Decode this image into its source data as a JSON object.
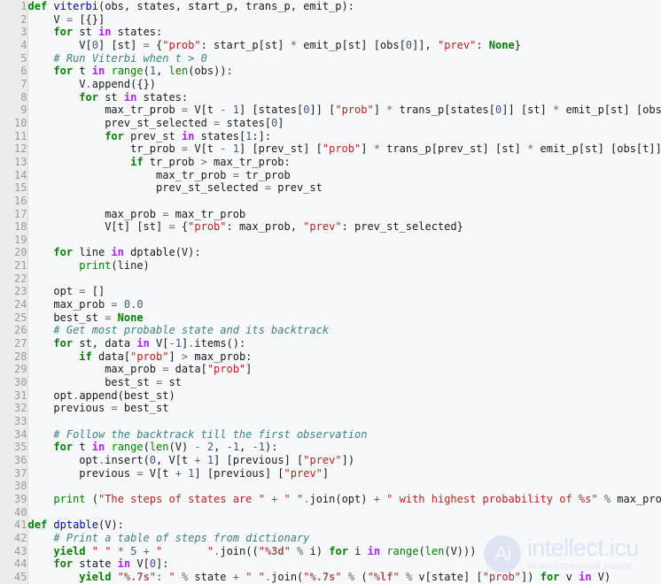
{
  "viewer": {
    "language": "python",
    "line_count": 45,
    "background_color": "#f7f8fa",
    "gutter_background_color": "#ececec",
    "gutter_text_color": "#9a9a9a",
    "first_line_number": 1
  },
  "watermark": {
    "badge_glyph": "Ai",
    "title": "intellect.icu",
    "subtitle": "Искусственный разум",
    "color": "#dde3f3"
  },
  "theme": {
    "keyword": "#008000",
    "keyword_operator": "#aa22ff",
    "function_name": "#0000c0",
    "builtin": "#008000",
    "string": "#ba2121",
    "string_format": "#a45a5a",
    "number": "#445588",
    "comment": "#408080",
    "operator": "#666666",
    "plain": "#1a1a1a"
  },
  "lines": [
    {
      "n": "1",
      "tokens": [
        [
          "kw",
          "def"
        ],
        [
          "pl",
          " "
        ],
        [
          "fn",
          "viterbi"
        ],
        [
          "pl",
          "(obs, states, start_p, trans_p, emit_p):"
        ]
      ]
    },
    {
      "n": "2",
      "tokens": [
        [
          "pl",
          "    V "
        ],
        [
          "op",
          "="
        ],
        [
          "pl",
          " [{}]"
        ]
      ]
    },
    {
      "n": "3",
      "tokens": [
        [
          "pl",
          "    "
        ],
        [
          "kw",
          "for"
        ],
        [
          "pl",
          " st "
        ],
        [
          "kwop",
          "in"
        ],
        [
          "pl",
          " states:"
        ]
      ]
    },
    {
      "n": "4",
      "tokens": [
        [
          "pl",
          "        V["
        ],
        [
          "num",
          "0"
        ],
        [
          "pl",
          "] [st] "
        ],
        [
          "op",
          "="
        ],
        [
          "pl",
          " {"
        ],
        [
          "str",
          "\"prob\""
        ],
        [
          "pl",
          ": start_p[st] "
        ],
        [
          "op",
          "*"
        ],
        [
          "pl",
          " emit_p[st] [obs["
        ],
        [
          "num",
          "0"
        ],
        [
          "pl",
          "]], "
        ],
        [
          "str",
          "\"prev\""
        ],
        [
          "pl",
          ": "
        ],
        [
          "kw",
          "None"
        ],
        [
          "pl",
          "}"
        ]
      ]
    },
    {
      "n": "5",
      "tokens": [
        [
          "pl",
          "    "
        ],
        [
          "com",
          "# Run Viterbi when t > 0"
        ]
      ]
    },
    {
      "n": "6",
      "tokens": [
        [
          "pl",
          "    "
        ],
        [
          "kw",
          "for"
        ],
        [
          "pl",
          " t "
        ],
        [
          "kwop",
          "in"
        ],
        [
          "pl",
          " "
        ],
        [
          "bi",
          "range"
        ],
        [
          "pl",
          "("
        ],
        [
          "num",
          "1"
        ],
        [
          "pl",
          ", "
        ],
        [
          "bi",
          "len"
        ],
        [
          "pl",
          "(obs)):"
        ]
      ]
    },
    {
      "n": "7",
      "tokens": [
        [
          "pl",
          "        V"
        ],
        [
          "op",
          "."
        ],
        [
          "pl",
          "append({})"
        ]
      ]
    },
    {
      "n": "8",
      "tokens": [
        [
          "pl",
          "        "
        ],
        [
          "kw",
          "for"
        ],
        [
          "pl",
          " st "
        ],
        [
          "kwop",
          "in"
        ],
        [
          "pl",
          " states:"
        ]
      ]
    },
    {
      "n": "9",
      "tokens": [
        [
          "pl",
          "            max_tr_prob "
        ],
        [
          "op",
          "="
        ],
        [
          "pl",
          " V[t "
        ],
        [
          "op",
          "-"
        ],
        [
          "pl",
          " "
        ],
        [
          "num",
          "1"
        ],
        [
          "pl",
          "] [states["
        ],
        [
          "num",
          "0"
        ],
        [
          "pl",
          "]] ["
        ],
        [
          "str",
          "\"prob\""
        ],
        [
          "pl",
          "] "
        ],
        [
          "op",
          "*"
        ],
        [
          "pl",
          " trans_p[states["
        ],
        [
          "num",
          "0"
        ],
        [
          "pl",
          "]] [st] "
        ],
        [
          "op",
          "*"
        ],
        [
          "pl",
          " emit_p[st] [obs[t]]"
        ]
      ]
    },
    {
      "n": "10",
      "tokens": [
        [
          "pl",
          "            prev_st_selected "
        ],
        [
          "op",
          "="
        ],
        [
          "pl",
          " states["
        ],
        [
          "num",
          "0"
        ],
        [
          "pl",
          "]"
        ]
      ]
    },
    {
      "n": "11",
      "tokens": [
        [
          "pl",
          "            "
        ],
        [
          "kw",
          "for"
        ],
        [
          "pl",
          " prev_st "
        ],
        [
          "kwop",
          "in"
        ],
        [
          "pl",
          " states["
        ],
        [
          "num",
          "1"
        ],
        [
          "pl",
          ":]:"
        ]
      ]
    },
    {
      "n": "12",
      "tokens": [
        [
          "pl",
          "                tr_prob "
        ],
        [
          "op",
          "="
        ],
        [
          "pl",
          " V[t "
        ],
        [
          "op",
          "-"
        ],
        [
          "pl",
          " "
        ],
        [
          "num",
          "1"
        ],
        [
          "pl",
          "] [prev_st] ["
        ],
        [
          "str",
          "\"prob\""
        ],
        [
          "pl",
          "] "
        ],
        [
          "op",
          "*"
        ],
        [
          "pl",
          " trans_p[prev_st] [st] "
        ],
        [
          "op",
          "*"
        ],
        [
          "pl",
          " emit_p[st] [obs[t]]"
        ]
      ]
    },
    {
      "n": "13",
      "tokens": [
        [
          "pl",
          "                "
        ],
        [
          "kw",
          "if"
        ],
        [
          "pl",
          " tr_prob "
        ],
        [
          "op",
          ">"
        ],
        [
          "pl",
          " max_tr_prob:"
        ]
      ]
    },
    {
      "n": "14",
      "tokens": [
        [
          "pl",
          "                    max_tr_prob "
        ],
        [
          "op",
          "="
        ],
        [
          "pl",
          " tr_prob"
        ]
      ]
    },
    {
      "n": "15",
      "tokens": [
        [
          "pl",
          "                    prev_st_selected "
        ],
        [
          "op",
          "="
        ],
        [
          "pl",
          " prev_st"
        ]
      ]
    },
    {
      "n": "16",
      "tokens": []
    },
    {
      "n": "17",
      "tokens": [
        [
          "pl",
          "            max_prob "
        ],
        [
          "op",
          "="
        ],
        [
          "pl",
          " max_tr_prob"
        ]
      ]
    },
    {
      "n": "18",
      "tokens": [
        [
          "pl",
          "            V[t] [st] "
        ],
        [
          "op",
          "="
        ],
        [
          "pl",
          " {"
        ],
        [
          "str",
          "\"prob\""
        ],
        [
          "pl",
          ": max_prob, "
        ],
        [
          "str",
          "\"prev\""
        ],
        [
          "pl",
          ": prev_st_selected}"
        ]
      ]
    },
    {
      "n": "19",
      "tokens": []
    },
    {
      "n": "20",
      "tokens": [
        [
          "pl",
          "    "
        ],
        [
          "kw",
          "for"
        ],
        [
          "pl",
          " line "
        ],
        [
          "kwop",
          "in"
        ],
        [
          "pl",
          " dptable(V):"
        ]
      ]
    },
    {
      "n": "21",
      "tokens": [
        [
          "pl",
          "        "
        ],
        [
          "bi",
          "print"
        ],
        [
          "pl",
          "(line)"
        ]
      ]
    },
    {
      "n": "22",
      "tokens": []
    },
    {
      "n": "23",
      "tokens": [
        [
          "pl",
          "    opt "
        ],
        [
          "op",
          "="
        ],
        [
          "pl",
          " []"
        ]
      ]
    },
    {
      "n": "24",
      "tokens": [
        [
          "pl",
          "    max_prob "
        ],
        [
          "op",
          "="
        ],
        [
          "pl",
          " "
        ],
        [
          "num",
          "0.0"
        ]
      ]
    },
    {
      "n": "25",
      "tokens": [
        [
          "pl",
          "    best_st "
        ],
        [
          "op",
          "="
        ],
        [
          "pl",
          " "
        ],
        [
          "kw",
          "None"
        ]
      ]
    },
    {
      "n": "26",
      "tokens": [
        [
          "pl",
          "    "
        ],
        [
          "com",
          "# Get most probable state and its backtrack"
        ]
      ]
    },
    {
      "n": "27",
      "tokens": [
        [
          "pl",
          "    "
        ],
        [
          "kw",
          "for"
        ],
        [
          "pl",
          " st, data "
        ],
        [
          "kwop",
          "in"
        ],
        [
          "pl",
          " V["
        ],
        [
          "op",
          "-"
        ],
        [
          "num",
          "1"
        ],
        [
          "pl",
          "]"
        ],
        [
          "op",
          "."
        ],
        [
          "pl",
          "items():"
        ]
      ]
    },
    {
      "n": "28",
      "tokens": [
        [
          "pl",
          "        "
        ],
        [
          "kw",
          "if"
        ],
        [
          "pl",
          " data["
        ],
        [
          "str",
          "\"prob\""
        ],
        [
          "pl",
          "] "
        ],
        [
          "op",
          ">"
        ],
        [
          "pl",
          " max_prob:"
        ]
      ]
    },
    {
      "n": "29",
      "tokens": [
        [
          "pl",
          "            max_prob "
        ],
        [
          "op",
          "="
        ],
        [
          "pl",
          " data["
        ],
        [
          "str",
          "\"prob\""
        ],
        [
          "pl",
          "]"
        ]
      ]
    },
    {
      "n": "30",
      "tokens": [
        [
          "pl",
          "            best_st "
        ],
        [
          "op",
          "="
        ],
        [
          "pl",
          " st"
        ]
      ]
    },
    {
      "n": "31",
      "tokens": [
        [
          "pl",
          "    opt"
        ],
        [
          "op",
          "."
        ],
        [
          "pl",
          "append(best_st)"
        ]
      ]
    },
    {
      "n": "32",
      "tokens": [
        [
          "pl",
          "    previous "
        ],
        [
          "op",
          "="
        ],
        [
          "pl",
          " best_st"
        ]
      ]
    },
    {
      "n": "33",
      "tokens": []
    },
    {
      "n": "34",
      "tokens": [
        [
          "pl",
          "    "
        ],
        [
          "com",
          "# Follow the backtrack till the first observation"
        ]
      ]
    },
    {
      "n": "35",
      "tokens": [
        [
          "pl",
          "    "
        ],
        [
          "kw",
          "for"
        ],
        [
          "pl",
          " t "
        ],
        [
          "kwop",
          "in"
        ],
        [
          "pl",
          " "
        ],
        [
          "bi",
          "range"
        ],
        [
          "pl",
          "("
        ],
        [
          "bi",
          "len"
        ],
        [
          "pl",
          "(V) "
        ],
        [
          "op",
          "-"
        ],
        [
          "pl",
          " "
        ],
        [
          "num",
          "2"
        ],
        [
          "pl",
          ", "
        ],
        [
          "op",
          "-"
        ],
        [
          "num",
          "1"
        ],
        [
          "pl",
          ", "
        ],
        [
          "op",
          "-"
        ],
        [
          "num",
          "1"
        ],
        [
          "pl",
          "):"
        ]
      ]
    },
    {
      "n": "36",
      "tokens": [
        [
          "pl",
          "        opt"
        ],
        [
          "op",
          "."
        ],
        [
          "pl",
          "insert("
        ],
        [
          "num",
          "0"
        ],
        [
          "pl",
          ", V[t "
        ],
        [
          "op",
          "+"
        ],
        [
          "pl",
          " "
        ],
        [
          "num",
          "1"
        ],
        [
          "pl",
          "] [previous] ["
        ],
        [
          "str",
          "\"prev\""
        ],
        [
          "pl",
          "])"
        ]
      ]
    },
    {
      "n": "37",
      "tokens": [
        [
          "pl",
          "        previous "
        ],
        [
          "op",
          "="
        ],
        [
          "pl",
          " V[t "
        ],
        [
          "op",
          "+"
        ],
        [
          "pl",
          " "
        ],
        [
          "num",
          "1"
        ],
        [
          "pl",
          "] [previous] ["
        ],
        [
          "str",
          "\"prev\""
        ],
        [
          "pl",
          "]"
        ]
      ]
    },
    {
      "n": "38",
      "tokens": []
    },
    {
      "n": "39",
      "tokens": [
        [
          "pl",
          "    "
        ],
        [
          "bi",
          "print"
        ],
        [
          "pl",
          " ("
        ],
        [
          "str",
          "\"The steps of states are \""
        ],
        [
          "pl",
          " "
        ],
        [
          "op",
          "+"
        ],
        [
          "pl",
          " "
        ],
        [
          "str",
          "\" \""
        ],
        [
          "op",
          "."
        ],
        [
          "pl",
          "join(opt) "
        ],
        [
          "op",
          "+"
        ],
        [
          "pl",
          " "
        ],
        [
          "str",
          "\" with highest probability of %s\""
        ],
        [
          "pl",
          " "
        ],
        [
          "op",
          "%"
        ],
        [
          "pl",
          " max_prob)"
        ]
      ]
    },
    {
      "n": "40",
      "tokens": []
    },
    {
      "n": "41",
      "tokens": [
        [
          "kw",
          "def"
        ],
        [
          "pl",
          " "
        ],
        [
          "fn",
          "dptable"
        ],
        [
          "pl",
          "(V):"
        ]
      ]
    },
    {
      "n": "42",
      "tokens": [
        [
          "pl",
          "    "
        ],
        [
          "com",
          "# Print a table of steps from dictionary"
        ]
      ]
    },
    {
      "n": "43",
      "tokens": [
        [
          "pl",
          "    "
        ],
        [
          "kw",
          "yield"
        ],
        [
          "pl",
          " "
        ],
        [
          "str",
          "\" \""
        ],
        [
          "pl",
          " "
        ],
        [
          "op",
          "*"
        ],
        [
          "pl",
          " "
        ],
        [
          "num",
          "5"
        ],
        [
          "pl",
          " "
        ],
        [
          "op",
          "+"
        ],
        [
          "pl",
          " "
        ],
        [
          "str",
          "\"       \""
        ],
        [
          "op",
          "."
        ],
        [
          "pl",
          "join(("
        ],
        [
          "str",
          "\""
        ],
        [
          "fmt",
          "%3d"
        ],
        [
          "str",
          "\""
        ],
        [
          "pl",
          " "
        ],
        [
          "op",
          "%"
        ],
        [
          "pl",
          " i) "
        ],
        [
          "kw",
          "for"
        ],
        [
          "pl",
          " i "
        ],
        [
          "kwop",
          "in"
        ],
        [
          "pl",
          " "
        ],
        [
          "bi",
          "range"
        ],
        [
          "pl",
          "("
        ],
        [
          "bi",
          "len"
        ],
        [
          "pl",
          "(V)))"
        ]
      ]
    },
    {
      "n": "44",
      "tokens": [
        [
          "pl",
          "    "
        ],
        [
          "kw",
          "for"
        ],
        [
          "pl",
          " state "
        ],
        [
          "kwop",
          "in"
        ],
        [
          "pl",
          " V["
        ],
        [
          "num",
          "0"
        ],
        [
          "pl",
          "]:"
        ]
      ]
    },
    {
      "n": "45",
      "tokens": [
        [
          "pl",
          "        "
        ],
        [
          "kw",
          "yield"
        ],
        [
          "pl",
          " "
        ],
        [
          "str",
          "\""
        ],
        [
          "fmt",
          "%.7s"
        ],
        [
          "str",
          "\": \""
        ],
        [
          "pl",
          " "
        ],
        [
          "op",
          "%"
        ],
        [
          "pl",
          " state "
        ],
        [
          "op",
          "+"
        ],
        [
          "pl",
          " "
        ],
        [
          "str",
          "\" \""
        ],
        [
          "op",
          "."
        ],
        [
          "pl",
          "join("
        ],
        [
          "str",
          "\""
        ],
        [
          "fmt",
          "%.7s"
        ],
        [
          "str",
          "\""
        ],
        [
          "pl",
          " "
        ],
        [
          "op",
          "%"
        ],
        [
          "pl",
          " ("
        ],
        [
          "str",
          "\""
        ],
        [
          "fmt",
          "%lf"
        ],
        [
          "str",
          "\""
        ],
        [
          "pl",
          " "
        ],
        [
          "op",
          "%"
        ],
        [
          "pl",
          " v[state] ["
        ],
        [
          "str",
          "\"prob\""
        ],
        [
          "pl",
          "]) "
        ],
        [
          "kw",
          "for"
        ],
        [
          "pl",
          " v "
        ],
        [
          "kwop",
          "in"
        ],
        [
          "pl",
          " V)"
        ]
      ]
    }
  ]
}
